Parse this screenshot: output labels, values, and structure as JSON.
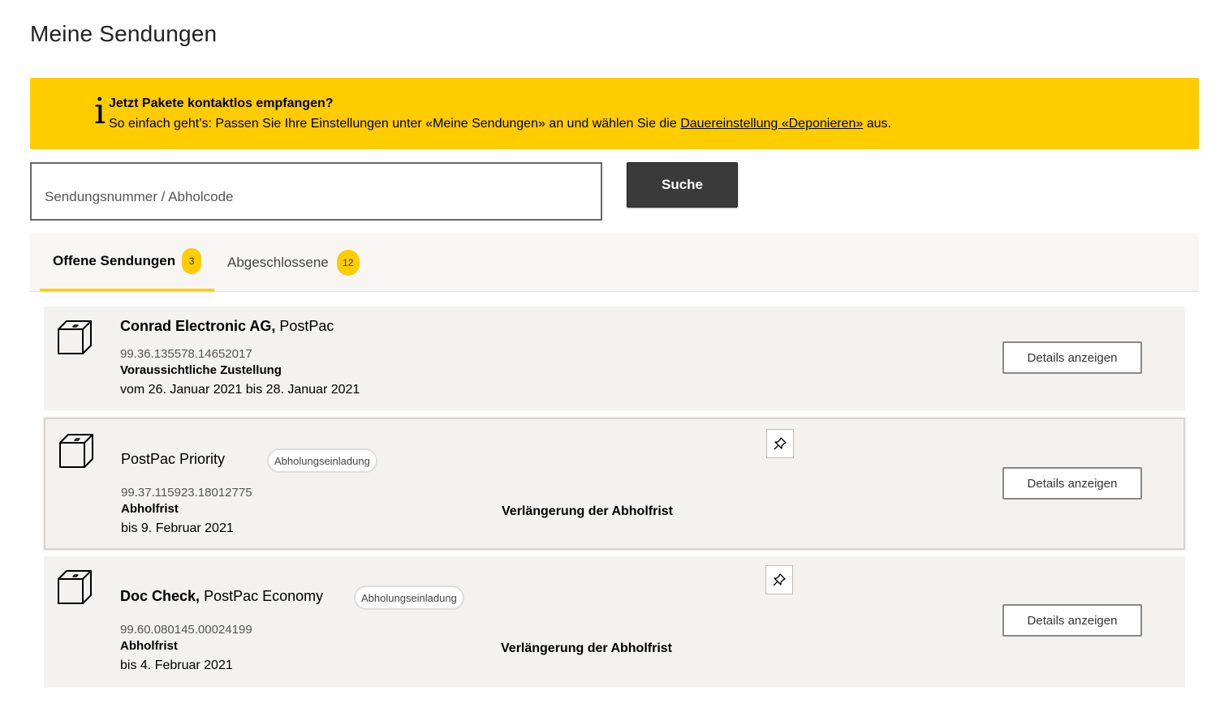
{
  "page": {
    "title": "Meine Sendungen"
  },
  "notice": {
    "icon": "info-icon",
    "icon_glyph": "i",
    "title": "Jetzt Pakete kontaktlos empfangen?",
    "text_before": "So einfach geht’s: Passen Sie Ihre Einstellungen unter «Meine Sendungen» an und wählen Sie die ",
    "link_text": "Dauereinstellung «Deponieren»",
    "text_after": " aus.",
    "background_color": "#ffcc00"
  },
  "search": {
    "placeholder": "Sendungsnummer / Abholcode",
    "value": "",
    "button_label": "Suche"
  },
  "tabs": [
    {
      "label": "Offene Sendungen",
      "count": "3",
      "active": true
    },
    {
      "label": "Abgeschlossene",
      "count": "12",
      "active": false
    }
  ],
  "shipments": [
    {
      "icon": "package-icon",
      "sender": "Conrad Electronic AG,",
      "product": "PostPac",
      "tracking_number": "99.36.135578.14652017",
      "date_label": "Voraussichtliche Zustellung",
      "date_value": "vom 26. Januar 2021 bis 28. Januar 2021",
      "details_label": "Details anzeigen"
    },
    {
      "icon": "package-icon",
      "sender": "",
      "product": "PostPac Priority",
      "status": "Abholungseinladung",
      "pin_icon": "pin-icon",
      "tracking_number": "99.37.115923.18012775",
      "date_label": "Abholfrist",
      "date_value": "bis 9. Februar 2021",
      "action_label": "Verlängerung der Abholfrist",
      "details_label": "Details anzeigen"
    },
    {
      "icon": "package-icon",
      "sender": "Doc Check,",
      "product": "PostPac Economy",
      "status": "Abholungseinladung",
      "pin_icon": "pin-icon",
      "tracking_number": "99.60.080145.00024199",
      "date_label": "Abholfrist",
      "date_value": "bis 4. Februar 2021",
      "action_label": "Verlängerung der Abholfrist",
      "details_label": "Details anzeigen"
    }
  ]
}
